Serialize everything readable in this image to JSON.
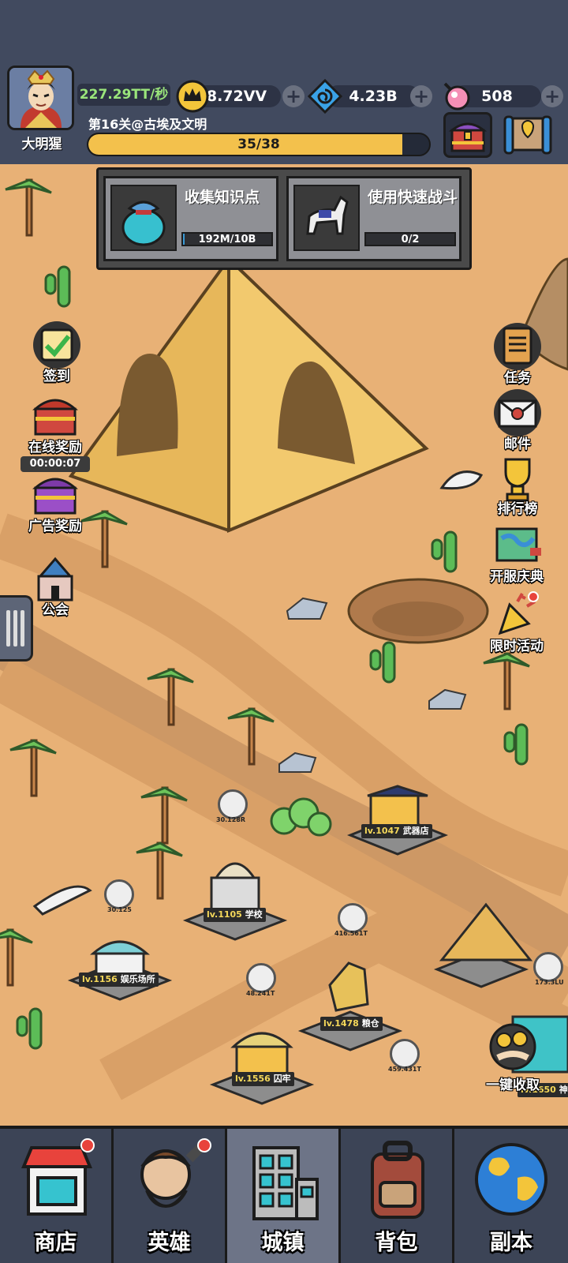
{
  "player": {
    "name": "大明猩",
    "income_rate": "227.29TT/秒"
  },
  "resources": [
    {
      "icon": "crown-coin-icon",
      "value": "8.72VV"
    },
    {
      "icon": "spiral-gem-icon",
      "value": "4.23B"
    },
    {
      "icon": "candy-icon",
      "value": "508"
    }
  ],
  "stage": {
    "label": "第16关@古埃及文明",
    "progress_text": "35/38",
    "progress_fraction": 0.921
  },
  "quests": [
    {
      "title": "收集知识点",
      "progress_text": "192M/10B",
      "fraction": 0.02,
      "icon": "knowledge-bag-icon"
    },
    {
      "title": "使用快速战斗",
      "progress_text": "0/2",
      "fraction": 0,
      "icon": "horse-icon"
    }
  ],
  "left_buttons": [
    {
      "label": "签到",
      "icon": "checkin-icon"
    },
    {
      "label": "在线奖励",
      "icon": "online-chest-icon"
    },
    {
      "label": "广告奖励",
      "icon": "ad-chest-icon"
    },
    {
      "label": "公会",
      "icon": "castle-icon"
    }
  ],
  "online_timer": "00:00:07",
  "right_buttons": [
    {
      "label": "任务",
      "icon": "task-list-icon"
    },
    {
      "label": "邮件",
      "icon": "mail-icon"
    },
    {
      "label": "排行榜",
      "icon": "trophy-icon"
    },
    {
      "label": "开服庆典",
      "icon": "map-scroll-icon"
    },
    {
      "label": "限时活动",
      "icon": "party-popper-icon"
    }
  ],
  "buildings": [
    {
      "level": "lv.1047",
      "name": "武器店",
      "coin": ""
    },
    {
      "level": "lv.1105",
      "name": "学校",
      "coin": "30.128R"
    },
    {
      "level": "lv.1156",
      "name": "娱乐场所",
      "coin": "30.125"
    },
    {
      "level": "lv.1478",
      "name": "粮仓",
      "coin": "416.561T"
    },
    {
      "level": "lv.1556",
      "name": "囚牢",
      "coin": "48.241T"
    },
    {
      "level": "lv.1650",
      "name": "神",
      "coin": "173.3LU"
    }
  ],
  "extra_coin": "459.431T",
  "collect_all_label": "一键收取",
  "nav": [
    {
      "label": "商店",
      "icon": "shop-icon",
      "active": false,
      "dot": true
    },
    {
      "label": "英雄",
      "icon": "caveman-hero-icon",
      "active": false,
      "dot": true
    },
    {
      "label": "城镇",
      "icon": "town-building-icon",
      "active": true,
      "dot": false
    },
    {
      "label": "背包",
      "icon": "backpack-icon",
      "active": false,
      "dot": false
    },
    {
      "label": "副本",
      "icon": "globe-icon",
      "active": false,
      "dot": false
    }
  ],
  "colors": {
    "hud_bg": "#414a5f",
    "sand": "#e8b176",
    "progress": "#f3c14c",
    "rate_green": "#9ae57b"
  }
}
